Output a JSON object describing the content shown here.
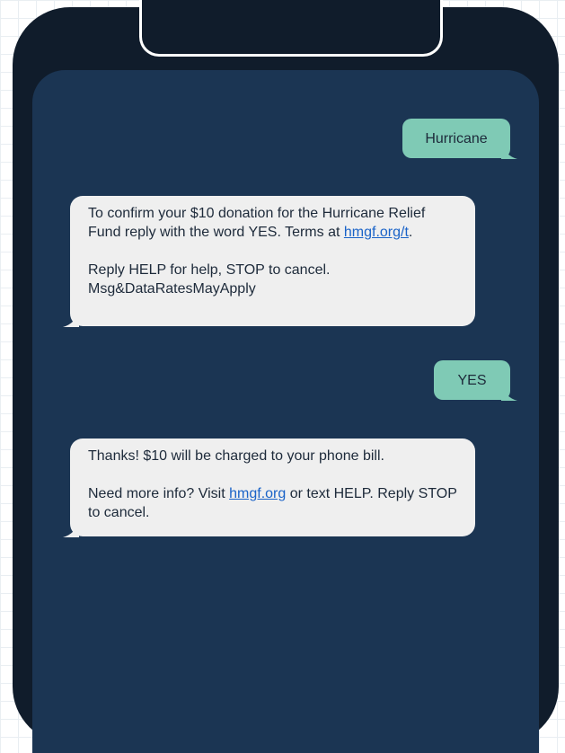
{
  "messages": [
    {
      "direction": "sent",
      "text": "Hurricane"
    },
    {
      "direction": "received",
      "lines": {
        "pre": "To confirm your $10 donation for the Hurricane Relief Fund reply with the word YES. Terms at ",
        "link": "hmgf.org/t",
        "post": ".",
        "p2": "Reply HELP for help, STOP to cancel. Msg&DataRatesMayApply"
      }
    },
    {
      "direction": "sent",
      "text": "YES"
    },
    {
      "direction": "received",
      "lines": {
        "p1": "Thanks! $10 will be charged to your phone bill.",
        "pre": "Need more info? Visit ",
        "link": "hmgf.org",
        "post": " or text HELP. Reply STOP to cancel."
      }
    }
  ],
  "colors": {
    "phone_frame": "#101c2b",
    "screen": "#1b3553",
    "sent_bubble": "#7fcab5",
    "received_bubble": "#efefef",
    "link": "#1a63c8"
  }
}
